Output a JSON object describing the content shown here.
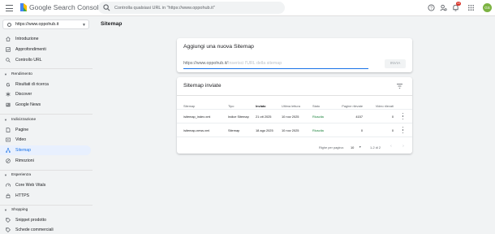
{
  "header": {
    "app_title": "Google Search Console",
    "search_placeholder": "Controlla qualsiasi URL in \"https://www.oppohub.it\"",
    "notification_count": "10",
    "avatar_initials": "GS"
  },
  "property": {
    "label": "https://www.oppohub.it"
  },
  "sidebar": {
    "top_items": [
      {
        "label": "Introduzione",
        "icon": "home-icon"
      },
      {
        "label": "Approfondimenti",
        "icon": "insights-icon"
      },
      {
        "label": "Controllo URL",
        "icon": "search-icon"
      }
    ],
    "sections": [
      {
        "title": "Rendimento",
        "items": [
          {
            "label": "Risultati di ricerca",
            "icon": "google-g-icon"
          },
          {
            "label": "Discover",
            "icon": "asterisk-icon"
          },
          {
            "label": "Google News",
            "icon": "news-icon"
          }
        ]
      },
      {
        "title": "Indicizzazione",
        "items": [
          {
            "label": "Pagine",
            "icon": "pages-icon"
          },
          {
            "label": "Video",
            "icon": "video-icon"
          },
          {
            "label": "Sitemap",
            "icon": "sitemap-icon",
            "active": true
          },
          {
            "label": "Rimozioni",
            "icon": "removals-icon"
          }
        ]
      },
      {
        "title": "Esperienza",
        "items": [
          {
            "label": "Core Web Vitals",
            "icon": "speed-icon"
          },
          {
            "label": "HTTPS",
            "icon": "lock-icon"
          }
        ]
      },
      {
        "title": "Shopping",
        "items": [
          {
            "label": "Snippet prodotto",
            "icon": "tag-icon"
          },
          {
            "label": "Schede commerciali",
            "icon": "tag-icon"
          }
        ]
      }
    ]
  },
  "main": {
    "page_title": "Sitemap",
    "add_card": {
      "title": "Aggiungi una nuova Sitemap",
      "url_prefix": "https://www.oppohub.it/",
      "input_placeholder": "Inserisci l'URL della sitemap",
      "submit_label": "INVIA"
    },
    "submitted_card": {
      "title": "Sitemap inviate",
      "columns": [
        "Sitemap",
        "Tipo",
        "Inviato",
        "Ultima lettura",
        "Stato",
        "Pagine rilevate",
        "Video rilevati"
      ],
      "rows": [
        {
          "sitemap": "/sitemap_index.xml",
          "tipo": "Indice Sitemap",
          "inviato": "21 ott 2025",
          "ultima_lettura": "10 nov 2025",
          "stato": "Riuscita",
          "pagine": "4157",
          "video": "0"
        },
        {
          "sitemap": "/sitemap-news.xml",
          "tipo": "Sitemap",
          "inviato": "18 ago 2025",
          "ultima_lettura": "10 nov 2025",
          "stato": "Riuscita",
          "pagine": "0",
          "video": "0"
        }
      ],
      "pagination": {
        "rows_per_page_label": "Righe per pagina:",
        "rows_per_page_value": "10",
        "range_label": "1-2 di 2"
      }
    }
  },
  "colors": {
    "accent": "#1a73e8",
    "success": "#188038",
    "active_bg": "#e8f0fe"
  }
}
